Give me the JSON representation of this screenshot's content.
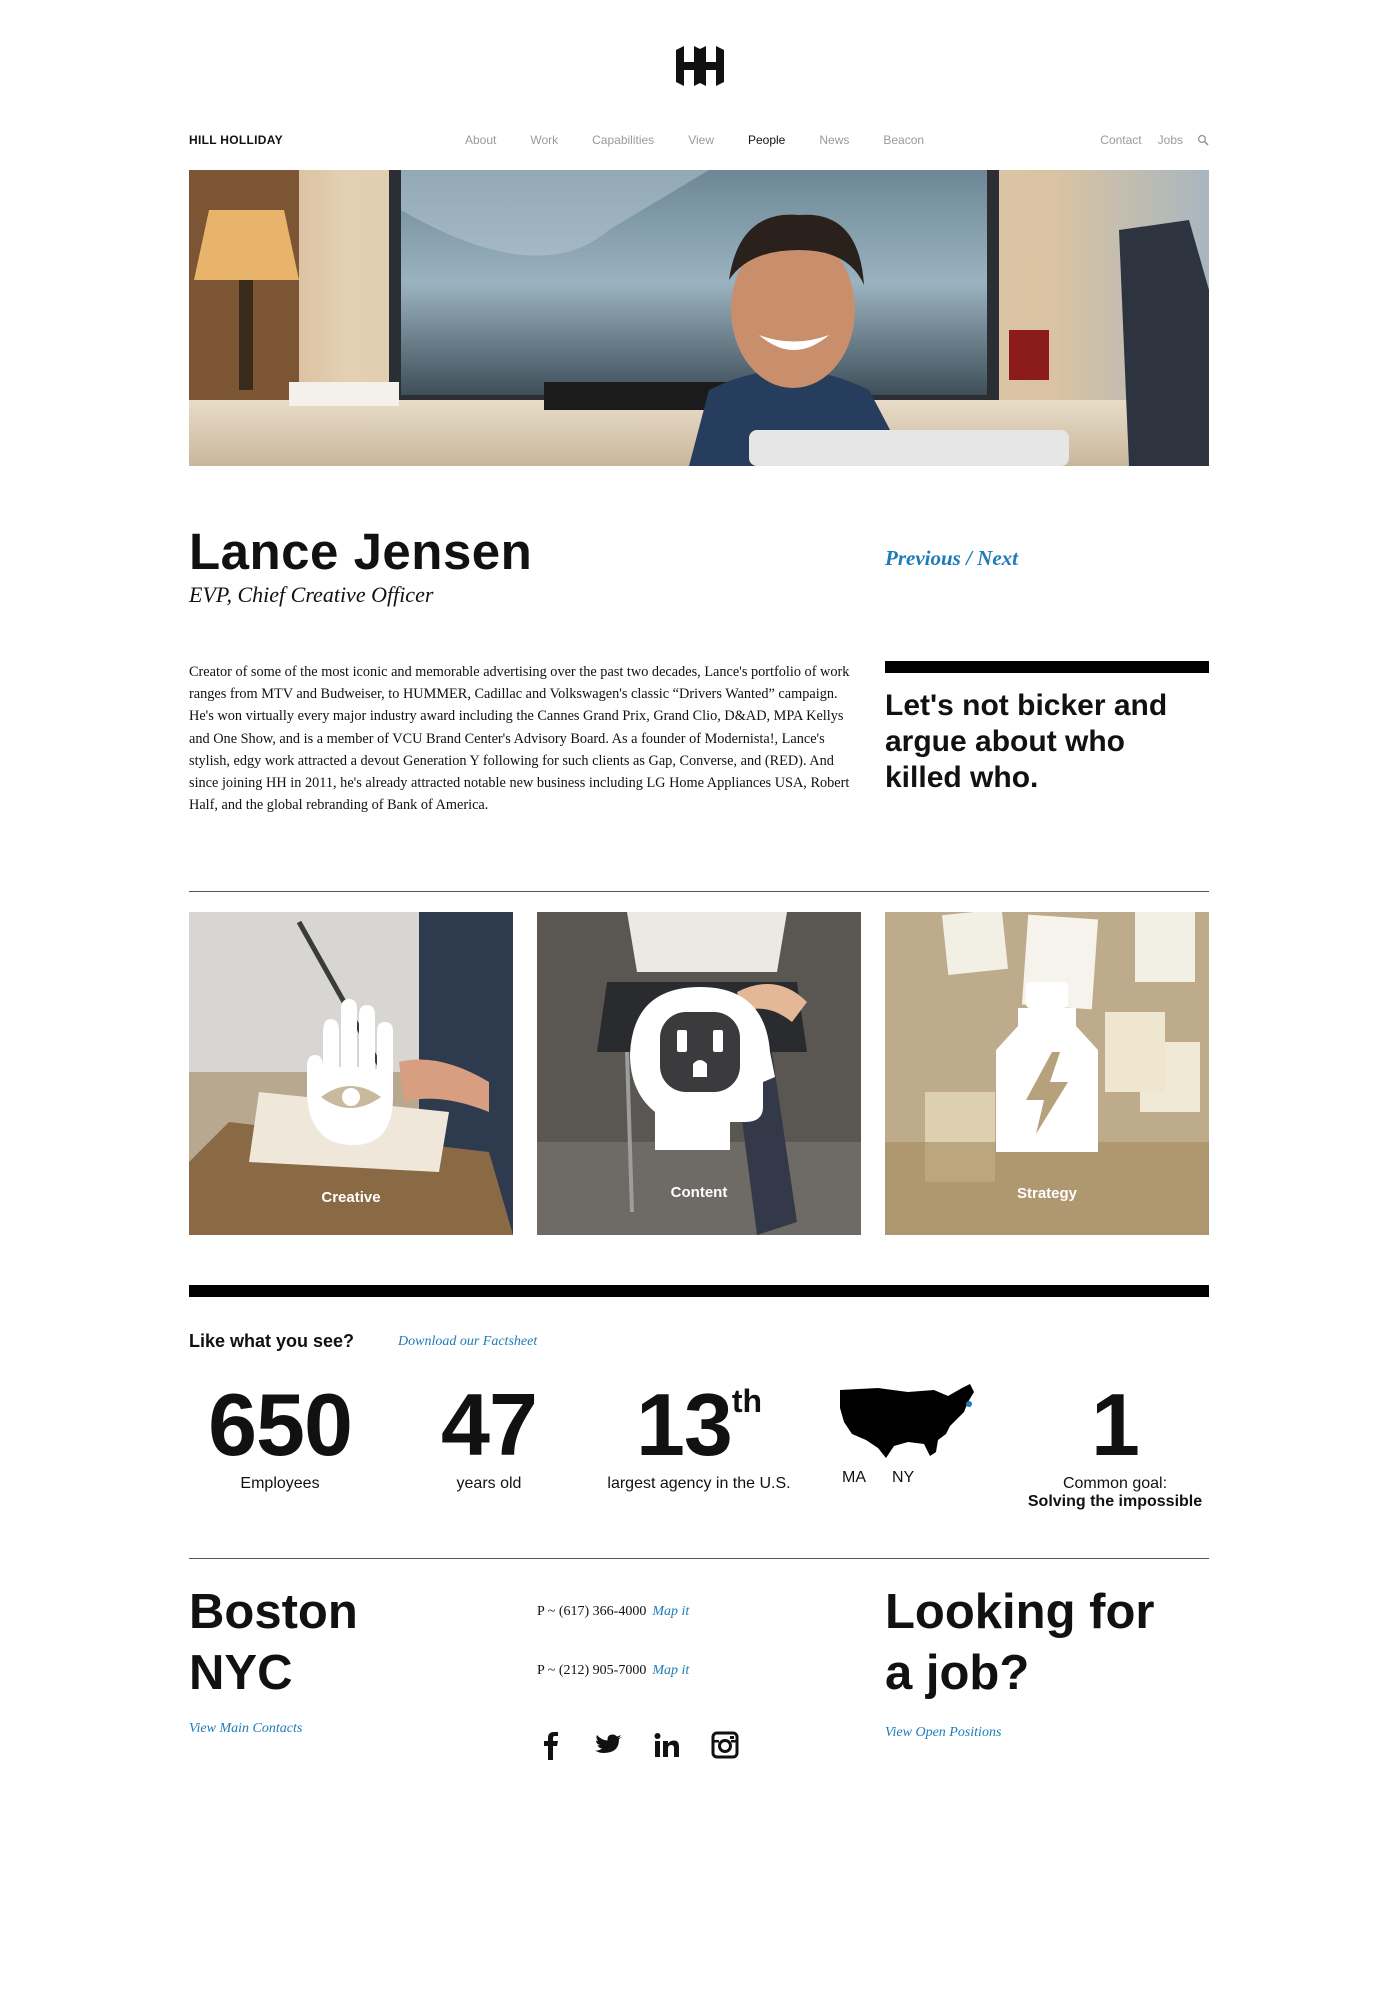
{
  "logo": {
    "icon": "hh-logo-icon"
  },
  "nav": {
    "brand": "HILL HOLLIDAY",
    "items": [
      {
        "label": "About",
        "active": false
      },
      {
        "label": "Work",
        "active": false
      },
      {
        "label": "Capabilities",
        "active": false
      },
      {
        "label": "View",
        "active": false
      },
      {
        "label": "People",
        "active": true
      },
      {
        "label": "News",
        "active": false
      },
      {
        "label": "Beacon",
        "active": false
      }
    ],
    "right": {
      "contact": "Contact",
      "jobs": "Jobs",
      "search_icon": "search-icon"
    }
  },
  "hero": {
    "icon": "portrait-photo"
  },
  "profile": {
    "name": "Lance Jensen",
    "title": "EVP, Chief Creative Officer",
    "previous": "Previous",
    "separator": " / ",
    "next": "Next",
    "bio": "Creator of some of the most iconic and memorable advertising over the past two decades, Lance's portfolio of work ranges from MTV and Budweiser, to HUMMER, Cadillac and Volkswagen's classic “Drivers Wanted” campaign. He's won virtually every major industry award including the Cannes Grand Prix, Grand Clio, D&AD, MPA Kellys and One Show, and is a member of VCU Brand Center's Advisory Board. As a founder of Modernista!, Lance's stylish, edgy work attracted a devout Generation Y following for such clients as Gap, Converse, and (RED). And since joining HH in 2011, he's already attracted notable new business including LG Home Appliances USA, Robert Half, and the global rebranding of Bank of America.",
    "quote": "Let's not bicker and argue about who killed who."
  },
  "capabilities": [
    {
      "label": "Creative",
      "icon": "hand-eye-icon"
    },
    {
      "label": "Content",
      "icon": "head-outlet-icon"
    },
    {
      "label": "Strategy",
      "icon": "bottle-bolt-icon"
    }
  ],
  "facts": {
    "heading": "Like what you see?",
    "factsheet_link": "Download our Factsheet",
    "stats": [
      {
        "number": "650",
        "label": "Employees"
      },
      {
        "number": "47",
        "label": "years old"
      },
      {
        "number": "13",
        "sup": "th",
        "label": "largest agency in the U.S."
      },
      {
        "icon": "us-map-icon",
        "locations": [
          "MA",
          "NY"
        ]
      },
      {
        "number": "1",
        "label": "Common goal:",
        "strong": "Solving the impossible"
      }
    ]
  },
  "footer": {
    "city1": "Boston",
    "city2": "NYC",
    "view_contacts": "View Main Contacts",
    "phone1": "P ~ (617) 366-4000",
    "phone2": "P ~ (212) 905-7000",
    "map_it": "Map it",
    "socials": [
      "facebook-icon",
      "twitter-icon",
      "linkedin-icon",
      "instagram-icon"
    ],
    "job_line1": "Looking for",
    "job_line2": "a job?",
    "view_positions": "View Open Positions"
  }
}
